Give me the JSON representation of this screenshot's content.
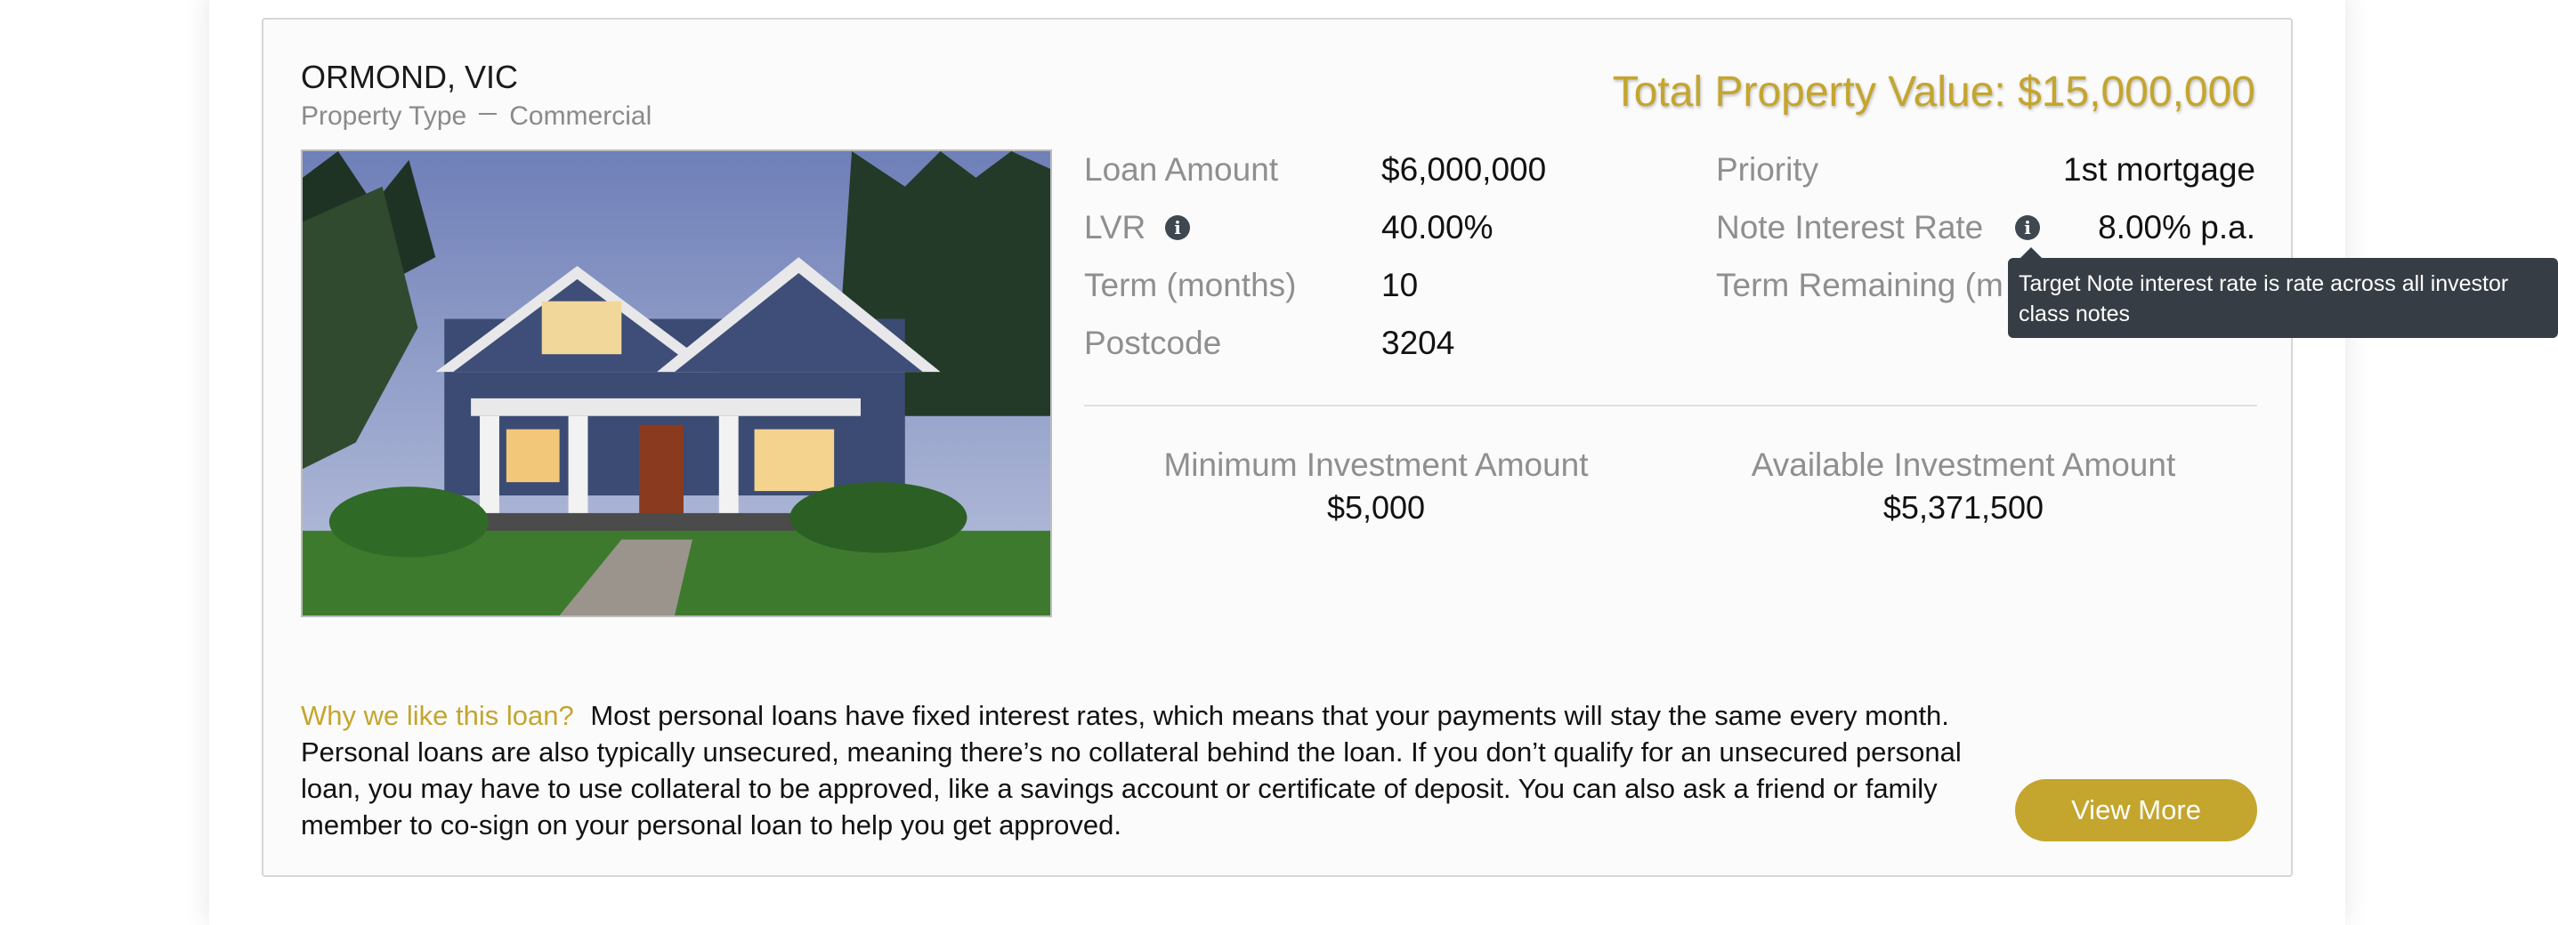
{
  "property": {
    "title": "ORMOND, VIC",
    "type_label": "Property Type",
    "type_value": "Commercial",
    "total_value": "Total Property Value: $15,000,000"
  },
  "details_left": [
    {
      "label": "Loan Amount",
      "value": "$6,000,000"
    },
    {
      "label": "LVR",
      "value": "40.00%"
    },
    {
      "label": "Term (months)",
      "value": "10"
    },
    {
      "label": "Postcode",
      "value": "3204"
    }
  ],
  "details_right": [
    {
      "label": "Priority",
      "value": "1st mortgage"
    },
    {
      "label": "Note Interest Rate",
      "value": "8.00% p.a."
    },
    {
      "label": "Term Remaining (m",
      "value": ""
    }
  ],
  "investment": {
    "min_label": "Minimum Investment Amount",
    "min_value": "$5,000",
    "avail_label": "Available Investment Amount",
    "avail_value": "$5,371,500"
  },
  "why": {
    "label": "Why we like this loan?",
    "text": "Most personal loans have fixed interest rates, which means that your payments will stay the same every month. Personal loans are also typically unsecured, meaning there’s no collateral behind the loan. If you don’t qualify for an unsecured personal loan, you may have to use collateral to be approved, like a savings account or certificate of deposit. You can also ask a friend or family member to co-sign on your personal loan to help you get approved."
  },
  "actions": {
    "view_more": "View More"
  },
  "tooltip": {
    "text": "Target Note interest rate is rate across all investor class notes"
  },
  "icons": {
    "info": "info-icon"
  },
  "colors": {
    "accent": "#c4a52e",
    "tooltip_bg": "#363d44",
    "label": "#8f8f8f"
  }
}
